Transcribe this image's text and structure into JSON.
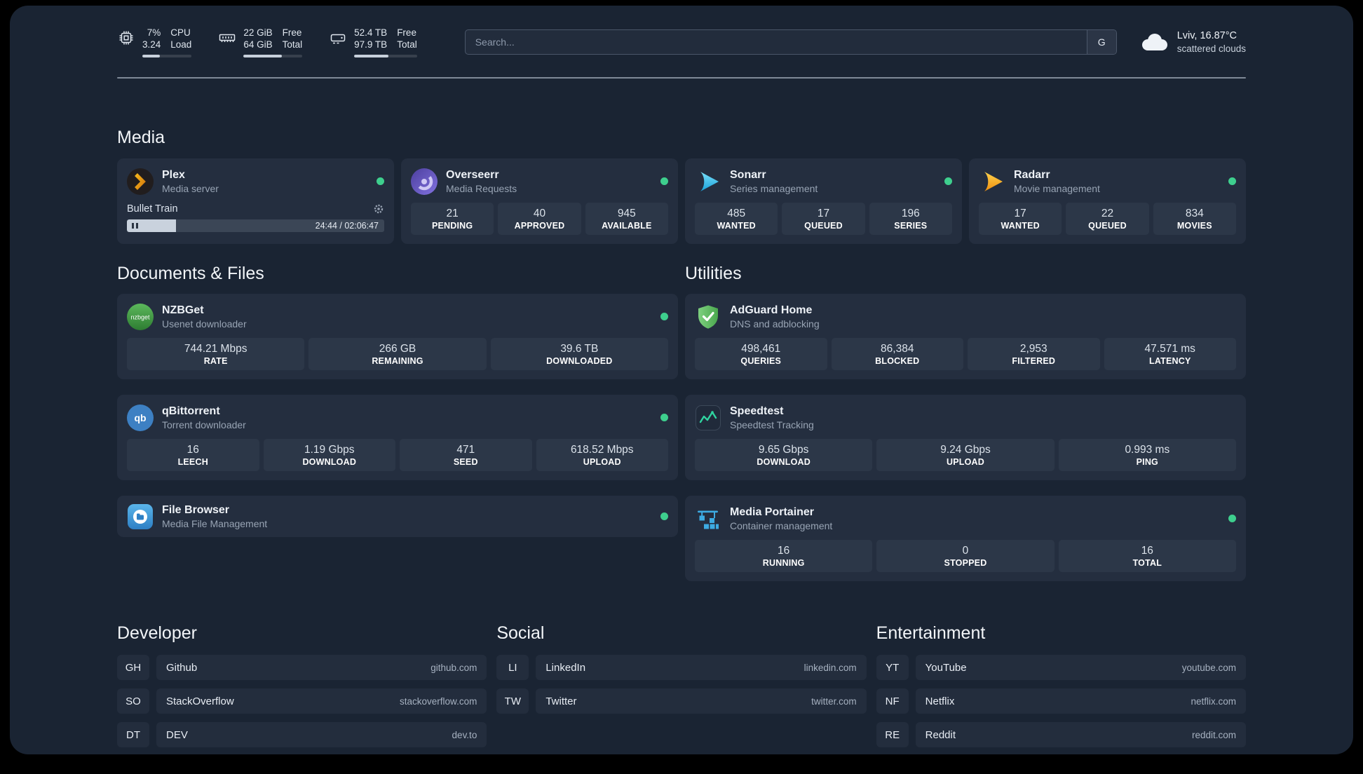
{
  "topbar": {
    "cpu": {
      "value1": "7%",
      "value2": "3.24",
      "label1": "CPU",
      "label2": "Load",
      "bar_pct": 35
    },
    "memory": {
      "value1": "22 GiB",
      "value2": "64 GiB",
      "label1": "Free",
      "label2": "Total",
      "bar_pct": 65
    },
    "disk": {
      "value1": "52.4 TB",
      "value2": "97.9 TB",
      "label1": "Free",
      "label2": "Total",
      "bar_pct": 55
    },
    "search": {
      "placeholder": "Search...",
      "button_label": "G"
    },
    "weather": {
      "icon": "cloud-icon",
      "location": "Lviv, 16.87°C",
      "condition": "scattered clouds"
    }
  },
  "media": {
    "title": "Media",
    "plex": {
      "name": "Plex",
      "desc": "Media server",
      "icon": "plex-icon",
      "status": "online",
      "now_playing": "Bullet Train",
      "time": "24:44 / 02:06:47",
      "progress_pct": 19
    },
    "overseerr": {
      "name": "Overseerr",
      "desc": "Media Requests",
      "icon": "overseerr-icon",
      "status": "online",
      "stats": [
        {
          "value": "21",
          "label": "PENDING"
        },
        {
          "value": "40",
          "label": "APPROVED"
        },
        {
          "value": "945",
          "label": "AVAILABLE"
        }
      ]
    },
    "sonarr": {
      "name": "Sonarr",
      "desc": "Series management",
      "icon": "sonarr-icon",
      "status": "online",
      "stats": [
        {
          "value": "485",
          "label": "WANTED"
        },
        {
          "value": "17",
          "label": "QUEUED"
        },
        {
          "value": "196",
          "label": "SERIES"
        }
      ]
    },
    "radarr": {
      "name": "Radarr",
      "desc": "Movie management",
      "icon": "radarr-icon",
      "status": "online",
      "stats": [
        {
          "value": "17",
          "label": "WANTED"
        },
        {
          "value": "22",
          "label": "QUEUED"
        },
        {
          "value": "834",
          "label": "MOVIES"
        }
      ]
    }
  },
  "documents": {
    "title": "Documents & Files",
    "nzbget": {
      "name": "NZBGet",
      "desc": "Usenet downloader",
      "icon": "nzbget-icon",
      "status": "online",
      "stats": [
        {
          "value": "744.21 Mbps",
          "label": "RATE"
        },
        {
          "value": "266 GB",
          "label": "REMAINING"
        },
        {
          "value": "39.6 TB",
          "label": "DOWNLOADED"
        }
      ]
    },
    "qbittorrent": {
      "name": "qBittorrent",
      "desc": "Torrent downloader",
      "icon": "qbittorrent-icon",
      "status": "online",
      "stats": [
        {
          "value": "16",
          "label": "LEECH"
        },
        {
          "value": "1.19 Gbps",
          "label": "DOWNLOAD"
        },
        {
          "value": "471",
          "label": "SEED"
        },
        {
          "value": "618.52 Mbps",
          "label": "UPLOAD"
        }
      ]
    },
    "filebrowser": {
      "name": "File Browser",
      "desc": "Media File Management",
      "icon": "filebrowser-icon",
      "status": "online"
    }
  },
  "utilities": {
    "title": "Utilities",
    "adguard": {
      "name": "AdGuard Home",
      "desc": "DNS and adblocking",
      "icon": "adguard-icon",
      "stats": [
        {
          "value": "498,461",
          "label": "QUERIES"
        },
        {
          "value": "86,384",
          "label": "BLOCKED"
        },
        {
          "value": "2,953",
          "label": "FILTERED"
        },
        {
          "value": "47.571 ms",
          "label": "LATENCY"
        }
      ]
    },
    "speedtest": {
      "name": "Speedtest",
      "desc": "Speedtest Tracking",
      "icon": "speedtest-icon",
      "stats": [
        {
          "value": "9.65 Gbps",
          "label": "DOWNLOAD"
        },
        {
          "value": "9.24 Gbps",
          "label": "UPLOAD"
        },
        {
          "value": "0.993 ms",
          "label": "PING"
        }
      ]
    },
    "portainer": {
      "name": "Media Portainer",
      "desc": "Container management",
      "icon": "portainer-icon",
      "status": "online",
      "stats": [
        {
          "value": "16",
          "label": "RUNNING"
        },
        {
          "value": "0",
          "label": "STOPPED"
        },
        {
          "value": "16",
          "label": "TOTAL"
        }
      ]
    }
  },
  "bookmarks": {
    "developer": {
      "title": "Developer",
      "items": [
        {
          "abbr": "GH",
          "name": "Github",
          "url": "github.com"
        },
        {
          "abbr": "SO",
          "name": "StackOverflow",
          "url": "stackoverflow.com"
        },
        {
          "abbr": "DT",
          "name": "DEV",
          "url": "dev.to"
        }
      ]
    },
    "social": {
      "title": "Social",
      "items": [
        {
          "abbr": "LI",
          "name": "LinkedIn",
          "url": "linkedin.com"
        },
        {
          "abbr": "TW",
          "name": "Twitter",
          "url": "twitter.com"
        }
      ]
    },
    "entertainment": {
      "title": "Entertainment",
      "items": [
        {
          "abbr": "YT",
          "name": "YouTube",
          "url": "youtube.com"
        },
        {
          "abbr": "NF",
          "name": "Netflix",
          "url": "netflix.com"
        },
        {
          "abbr": "RE",
          "name": "Reddit",
          "url": "reddit.com"
        }
      ]
    }
  },
  "colors": {
    "status_online": "#3ecf8e",
    "plex_accent": "#e8a117",
    "overseerr_accent": "#7e6fd8",
    "sonarr_accent": "#35b6e8",
    "radarr_accent": "#f5a623",
    "nzbget_accent": "#43a047",
    "qbittorrent_accent": "#3d80c3",
    "filebrowser_accent": "#4aa3dd",
    "adguard_accent": "#5fbf62",
    "speedtest_accent": "#2fd4a0",
    "portainer_accent": "#3dabe2"
  }
}
